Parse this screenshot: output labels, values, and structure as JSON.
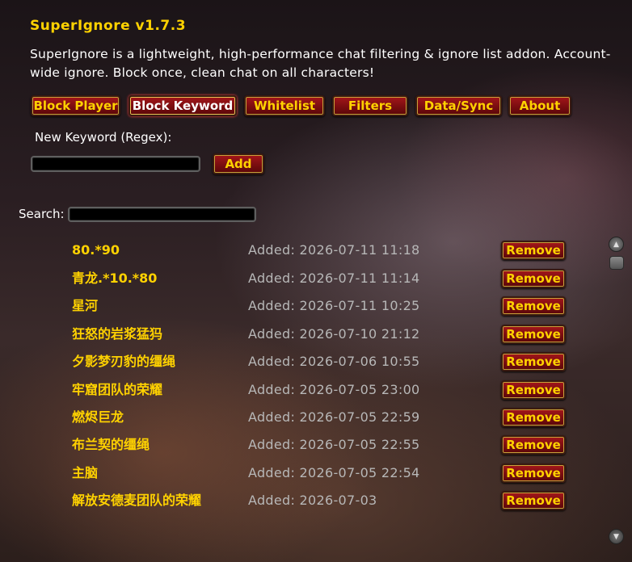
{
  "header": {
    "title": "SuperIgnore v1.7.3",
    "description": "SuperIgnore is a lightweight, high-performance chat filtering & ignore list addon. Account-wide ignore. Block once, clean chat on all characters!"
  },
  "tabs": [
    {
      "label": "Block Player",
      "active": false
    },
    {
      "label": "Block Keyword",
      "active": true
    },
    {
      "label": "Whitelist",
      "active": false
    },
    {
      "label": "Filters",
      "active": false
    },
    {
      "label": "Data/Sync",
      "active": false
    },
    {
      "label": "About",
      "active": false
    }
  ],
  "keyword_form": {
    "label": "New Keyword (Regex):",
    "value": "",
    "add_label": "Add"
  },
  "search": {
    "label": "Search:",
    "value": ""
  },
  "entries": [
    {
      "keyword": "80.*90",
      "added": "Added: 2026-07-11 11:18",
      "action": "Remove"
    },
    {
      "keyword": "青龙.*10.*80",
      "added": "Added: 2026-07-11 11:14",
      "action": "Remove"
    },
    {
      "keyword": "星河",
      "added": "Added: 2026-07-11 10:25",
      "action": "Remove"
    },
    {
      "keyword": "狂怒的岩浆猛犸",
      "added": "Added: 2026-07-10 21:12",
      "action": "Remove"
    },
    {
      "keyword": "夕影梦刃豹的缰绳",
      "added": "Added: 2026-07-06 10:55",
      "action": "Remove"
    },
    {
      "keyword": "牢窟团队的荣耀",
      "added": "Added: 2026-07-05 23:00",
      "action": "Remove"
    },
    {
      "keyword": "燃烬巨龙",
      "added": "Added: 2026-07-05 22:59",
      "action": "Remove"
    },
    {
      "keyword": "布兰契的缰绳",
      "added": "Added: 2026-07-05 22:55",
      "action": "Remove"
    },
    {
      "keyword": "主脑",
      "added": "Added: 2026-07-05 22:54",
      "action": "Remove"
    },
    {
      "keyword": "解放安德麦团队的荣耀",
      "added": "Added: 2026-07-03",
      "action": "Remove"
    }
  ],
  "scrollbar": {
    "up_icon": "scroll-up-arrow",
    "down_icon": "scroll-down-arrow"
  },
  "colors": {
    "title": "#ffd200",
    "keyword": "#ffd200",
    "date": "#b7b7b7",
    "button_bg": "#7a0d10"
  }
}
